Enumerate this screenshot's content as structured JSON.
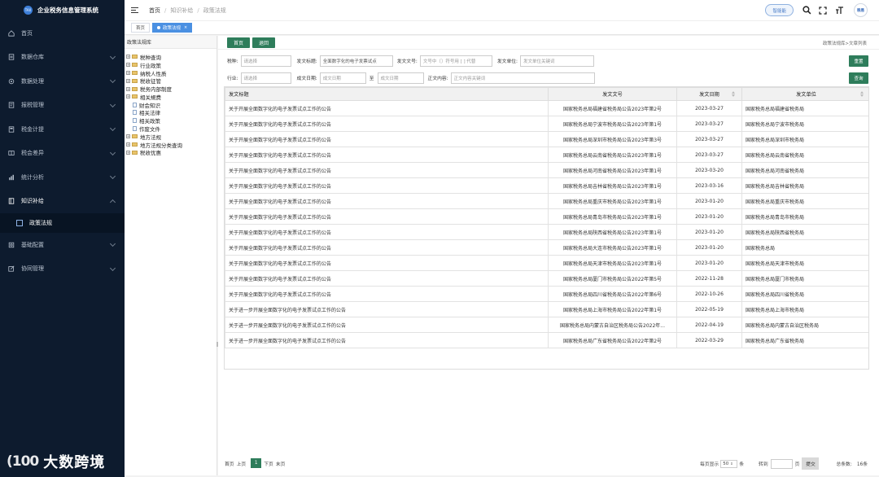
{
  "app": {
    "title": "企业税务信息管理系统",
    "logo_text": "TAX"
  },
  "sidebar": {
    "items": [
      {
        "label": "首页",
        "icon": "home-icon",
        "has_children": false
      },
      {
        "label": "数据仓库",
        "icon": "database-icon",
        "has_children": true
      },
      {
        "label": "数据处理",
        "icon": "gear-icon",
        "has_children": true
      },
      {
        "label": "报税管理",
        "icon": "report-icon",
        "has_children": true
      },
      {
        "label": "税金计提",
        "icon": "calculator-icon",
        "has_children": true
      },
      {
        "label": "税会差异",
        "icon": "compare-icon",
        "has_children": true
      },
      {
        "label": "统计分析",
        "icon": "chart-icon",
        "has_children": true
      },
      {
        "label": "知识补给",
        "icon": "book-icon",
        "has_children": true,
        "open": true
      },
      {
        "label": "基础配置",
        "icon": "config-icon",
        "has_children": true
      },
      {
        "label": "协同管理",
        "icon": "edit-icon",
        "has_children": true
      }
    ],
    "active_sub": "政策法规"
  },
  "watermark": {
    "mark": "(100",
    "text": "大数跨境"
  },
  "header": {
    "breadcrumb": [
      "首页",
      "知识补给",
      "政策法规"
    ],
    "smart_button": "智能能",
    "avatar_text": "税易"
  },
  "tabs": [
    {
      "label": "首页",
      "active": false
    },
    {
      "label": "政策法规",
      "active": true
    }
  ],
  "tree": {
    "title": "政策法规库",
    "nodes": [
      {
        "label": "税种查询",
        "expandable": true,
        "type": "folder"
      },
      {
        "label": "行业政策",
        "expandable": true,
        "type": "folder"
      },
      {
        "label": "纳税人性质",
        "expandable": true,
        "type": "folder"
      },
      {
        "label": "税收征管",
        "expandable": true,
        "type": "folder"
      },
      {
        "label": "税务内部制度",
        "expandable": true,
        "type": "folder"
      },
      {
        "label": "相关規费",
        "expandable": true,
        "type": "folder"
      },
      {
        "label": "财会知识",
        "expandable": false,
        "type": "file"
      },
      {
        "label": "相关法律",
        "expandable": false,
        "type": "file"
      },
      {
        "label": "相关政策",
        "expandable": false,
        "type": "file"
      },
      {
        "label": "作废文件",
        "expandable": false,
        "type": "file"
      },
      {
        "label": "地方法规",
        "expandable": true,
        "type": "folder"
      },
      {
        "label": "地方法规分类查询",
        "expandable": true,
        "type": "folder"
      },
      {
        "label": "税收优惠",
        "expandable": true,
        "type": "folder"
      }
    ]
  },
  "toolbar": {
    "home_button": "首页",
    "back_button": "退回",
    "path": "政策法规库>文章列表"
  },
  "filters": {
    "tax_label": "税种:",
    "tax_placeholder": "请选择",
    "title_label": "发文标题:",
    "title_value": "全面数字化的电子发票试点",
    "docno_label": "发文文号:",
    "docno_placeholder": "文号中〔〕符号用 [ ] 代替",
    "issuer_label": "发文单位:",
    "issuer_placeholder": "发文单位关键词",
    "industry_label": "行业:",
    "industry_placeholder": "请选择",
    "date_label": "成文日期:",
    "date_from_placeholder": "成文日期",
    "date_to_label": "至",
    "date_to_placeholder": "成文日期",
    "content_label": "正文内容:",
    "content_placeholder": "正文内容关键词",
    "reset_button": "重置",
    "query_button": "查询"
  },
  "table": {
    "columns": [
      "发文标题",
      "发文文号",
      "发文日期",
      "发文单位"
    ],
    "rows": [
      [
        "关于开展全面数字化的电子发票试点工作的公告",
        "国家税务总局福建省税务局公告2023年第2号",
        "2023-03-27",
        "国家税务总局福建省税务局"
      ],
      [
        "关于开展全面数字化的电子发票试点工作的公告",
        "国家税务总局宁波市税务局公告2023年第1号",
        "2023-03-27",
        "国家税务总局宁波市税务局"
      ],
      [
        "关于开展全面数字化的电子发票试点工作的公告",
        "国家税务总局深圳市税务局公告2023年第3号",
        "2023-03-27",
        "国家税务总局深圳市税务局"
      ],
      [
        "关于开展全面数字化的电子发票试点工作的公告",
        "国家税务总局云南省税务局公告2023年第1号",
        "2023-03-27",
        "国家税务总局云南省税务局"
      ],
      [
        "关于开展全面数字化的电子发票试点工作的公告",
        "国家税务总局河南省税务局公告2023年第1号",
        "2023-03-20",
        "国家税务总局河南省税务局"
      ],
      [
        "关于开展全面数字化的电子发票试点工作的公告",
        "国家税务总局吉林省税务局公告2023年第1号",
        "2023-03-16",
        "国家税务总局吉林省税务局"
      ],
      [
        "关于开展全面数字化的电子发票试点工作的公告",
        "国家税务总局重庆市税务局公告2023年第1号",
        "2023-01-20",
        "国家税务总局重庆市税务局"
      ],
      [
        "关于开展全面数字化的电子发票试点工作的公告",
        "国家税务总局青岛市税务局公告2023年第1号",
        "2023-01-20",
        "国家税务总局青岛市税务局"
      ],
      [
        "关于开展全面数字化的电子发票试点工作的公告",
        "国家税务总局陕西省税务局公告2023年第1号",
        "2023-01-20",
        "国家税务总局陕西省税务局"
      ],
      [
        "关于开展全面数字化的电子发票试点工作的公告",
        "国家税务总局大连市税务局公告2023年第1号",
        "2023-01-20",
        "国家税务总局"
      ],
      [
        "关于开展全面数字化的电子发票试点工作的公告",
        "国家税务总局天津市税务局公告2023年第1号",
        "2023-01-20",
        "国家税务总局天津市税务局"
      ],
      [
        "关于开展全面数字化的电子发票试点工作的公告",
        "国家税务总局厦门市税务局公告2022年第5号",
        "2022-11-28",
        "国家税务总局厦门市税务局"
      ],
      [
        "关于开展全面数字化的电子发票试点工作的公告",
        "国家税务总局四川省税务局公告2022年第6号",
        "2022-10-26",
        "国家税务总局四川省税务局"
      ],
      [
        "关于进一步开展全面数字化的电子发票试点工作的公告",
        "国家税务总局上海市税务局公告2022年第1号",
        "2022-05-19",
        "国家税务总局上海市税务局"
      ],
      [
        "关于进一步开展全面数字化的电子发票试点工作的公告",
        "国家税务总局内蒙古自治区税务局公告2022年...",
        "2022-04-19",
        "国家税务总局内蒙古自治区税务局"
      ],
      [
        "关于进一步开展全面数字化的电子发票试点工作的公告",
        "国家税务总局广东省税务局公告2022年第2号",
        "2022-03-29",
        "国家税务总局广东省税务局"
      ]
    ]
  },
  "pager": {
    "first": "首页",
    "prev": "上页",
    "current": "1",
    "next": "下页",
    "last": "末页",
    "per_page_label": "每页显示",
    "per_page_value": "50",
    "per_page_unit": "条",
    "goto_label": "转到",
    "goto_unit": "页",
    "submit": "提交",
    "total_label": "总条数:",
    "total_value": "16条"
  }
}
